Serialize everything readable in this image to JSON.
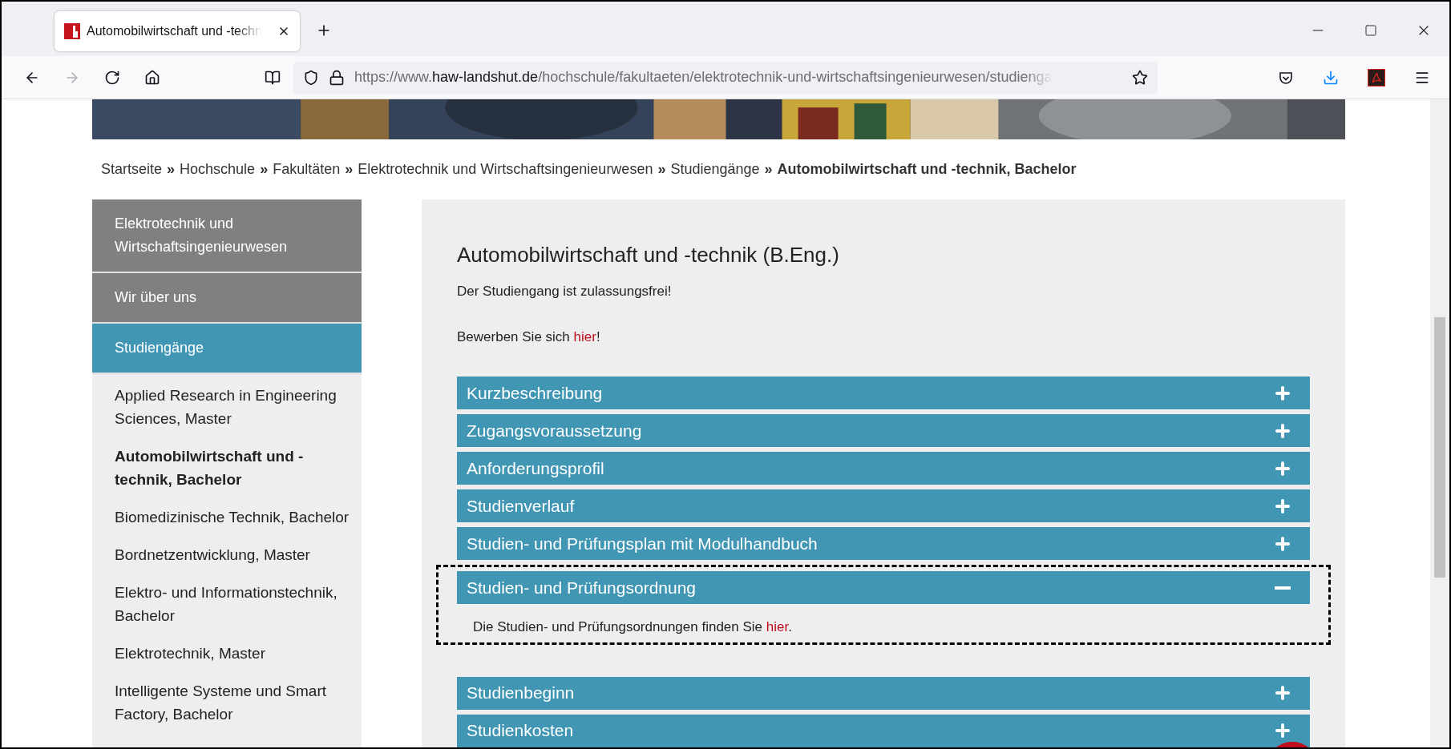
{
  "browser": {
    "tab": {
      "title": "Automobilwirtschaft und -techn",
      "selected": true
    },
    "url": {
      "scheme": "https://www.",
      "domain": "haw-landshut.de",
      "path": "/hochschule/fakultaeten/elektrotechnik-und-wirtschaftsingenieurwesen/studienga"
    }
  },
  "breadcrumb": {
    "separator": "»",
    "items": [
      {
        "label": "Startseite",
        "current": false
      },
      {
        "label": "Hochschule",
        "current": false
      },
      {
        "label": "Fakultäten",
        "current": false
      },
      {
        "label": "Elektrotechnik und Wirtschaftsingenieurwesen",
        "current": false
      },
      {
        "label": "Studiengänge",
        "current": false
      },
      {
        "label": "Automobilwirtschaft und -technik, Bachelor",
        "current": true
      }
    ]
  },
  "sidebar": {
    "sections": [
      {
        "label": "Elektrotechnik und Wirtschaftsingenieurwesen",
        "selected": false
      },
      {
        "label": "Wir über uns",
        "selected": false
      },
      {
        "label": "Studiengänge",
        "selected": true
      }
    ],
    "programs": [
      {
        "label": "Applied Research in Engineering Sciences, Master",
        "selected": false
      },
      {
        "label": "Automobilwirtschaft und -technik, Bachelor",
        "selected": true
      },
      {
        "label": "Biomedizinische Technik, Bachelor",
        "selected": false
      },
      {
        "label": "Bordnetzentwicklung, Master",
        "selected": false
      },
      {
        "label": "Elektro- und Informationstechnik, Bachelor",
        "selected": false
      },
      {
        "label": "Elektrotechnik, Master",
        "selected": false
      },
      {
        "label": "Intelligente Systeme und Smart Factory, Bachelor",
        "selected": false
      }
    ]
  },
  "main": {
    "title": "Automobilwirtschaft und -technik (B.Eng.)",
    "note": "Der Studiengang ist zulassungsfrei!",
    "apply": {
      "before": "Bewerben Sie sich ",
      "link": "hier",
      "after": "!"
    },
    "accordions": [
      {
        "title": "Kurzbeschreibung",
        "expanded": false,
        "highlighted": false
      },
      {
        "title": "Zugangsvoraussetzung",
        "expanded": false,
        "highlighted": false
      },
      {
        "title": "Anforderungsprofil",
        "expanded": false,
        "highlighted": false
      },
      {
        "title": "Studienverlauf",
        "expanded": false,
        "highlighted": false
      },
      {
        "title": "Studien- und Prüfungsplan mit Modulhandbuch",
        "expanded": false,
        "highlighted": false
      },
      {
        "title": "Studien- und Prüfungsordnung",
        "expanded": true,
        "highlighted": true,
        "content": {
          "before": "Die Studien- und Prüfungsordnungen finden Sie ",
          "link": "hier",
          "after": "."
        }
      },
      {
        "title": "Studienbeginn",
        "expanded": false,
        "highlighted": false
      },
      {
        "title": "Studienkosten",
        "expanded": false,
        "highlighted": false
      }
    ]
  }
}
